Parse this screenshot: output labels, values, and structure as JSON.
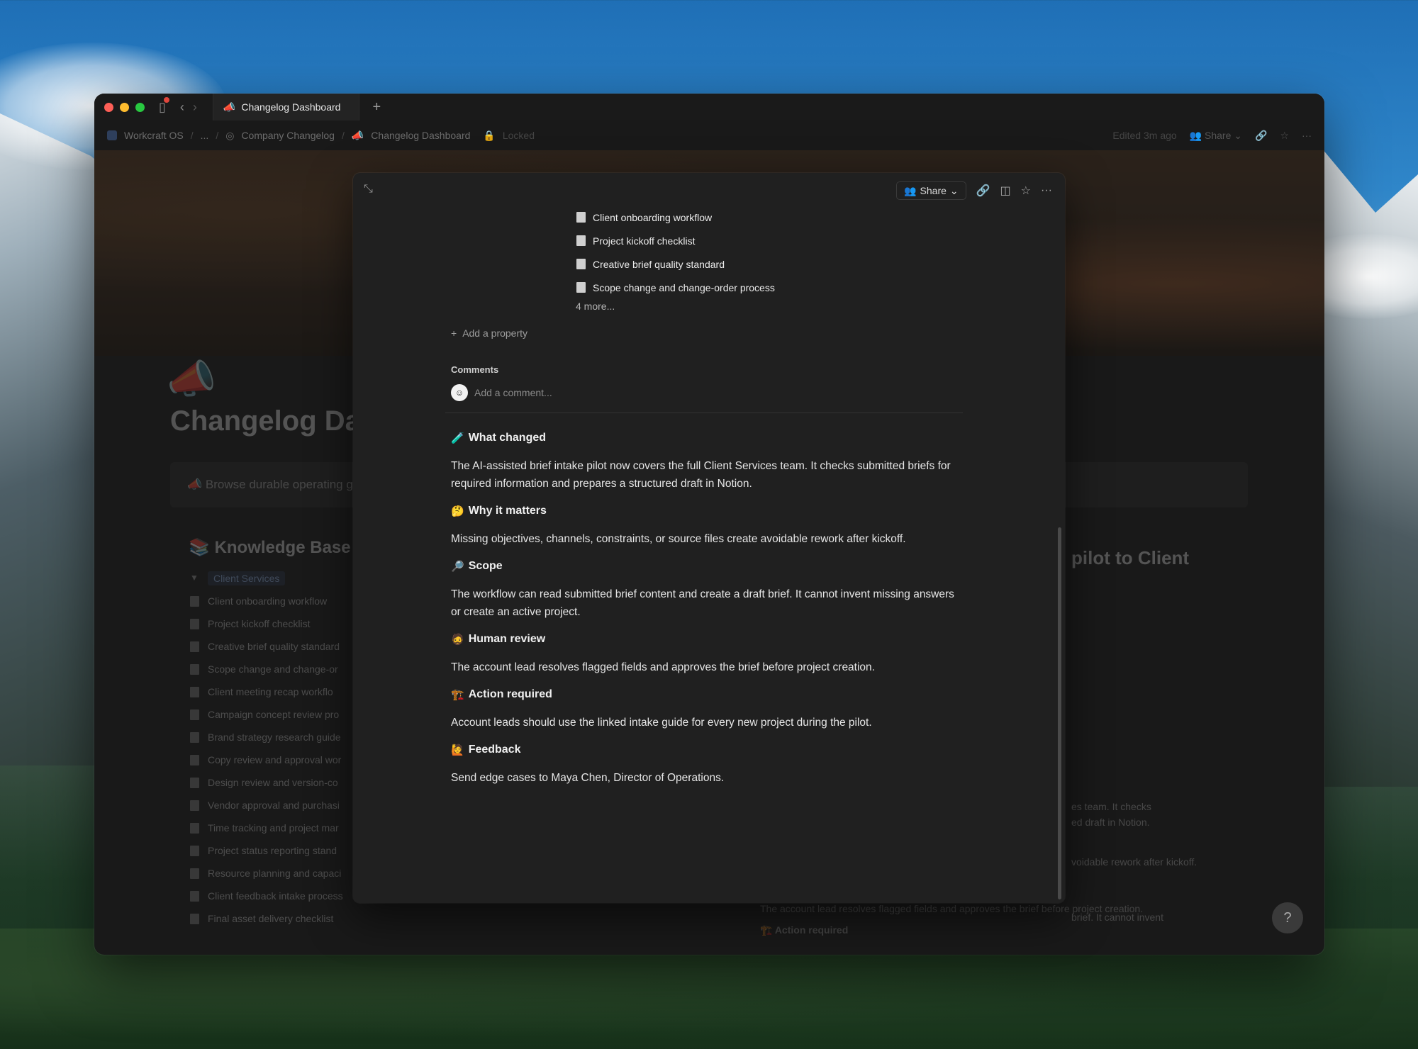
{
  "browser": {
    "tab_title": "Changelog Dashboard",
    "new_tab": "+"
  },
  "breadcrumb": {
    "items": [
      "Workcraft OS",
      "...",
      "Company Changelog",
      "Changelog Dashboard"
    ],
    "lock_label": "Locked"
  },
  "top_right": {
    "edited": "Edited 3m ago",
    "share": "Share"
  },
  "background_page": {
    "title": "Changelog Da",
    "callout": "Browse durable operating gu",
    "section_title": "Knowledge Base",
    "group_label": "Client Services",
    "items": [
      "Client onboarding workflow",
      "Project kickoff checklist",
      "Creative brief quality standard",
      "Scope change and change-or",
      "Client meeting recap workflo",
      "Campaign concept review pro",
      "Brand strategy research guide",
      "Copy review and approval wor",
      "Design review and version-co",
      "Vendor approval and purchasi",
      "Time tracking and project mar",
      "Project status reporting stand",
      "Resource planning and capaci",
      "Client feedback intake process",
      "Final asset delivery checklist"
    ],
    "right_title": "pilot to Client",
    "right_snippet_1": "es team. It checks",
    "right_snippet_2": "ed draft in Notion.",
    "right_snippet_3": "voidable rework after kickoff.",
    "right_snippet_4": "brief. It cannot invent",
    "bottom_text": "The account lead resolves flagged fields and approves the brief before project creation.",
    "bottom_heading": "Action required"
  },
  "modal": {
    "share_label": "Share",
    "related_pages": [
      "Client onboarding workflow",
      "Project kickoff checklist",
      "Creative brief quality standard",
      "Scope change and change-order process"
    ],
    "more_label": "4 more...",
    "add_property": "Add a property",
    "comments_label": "Comments",
    "comment_placeholder": "Add a comment...",
    "sections": [
      {
        "emoji": "🧪",
        "heading": "What changed",
        "text": "The AI-assisted brief intake pilot now covers the full Client Services team. It checks submitted briefs for required information and prepares a structured draft in Notion."
      },
      {
        "emoji": "🤔",
        "heading": "Why it matters",
        "text": "Missing objectives, channels, constraints, or source files create avoidable rework after kickoff."
      },
      {
        "emoji": "🔎",
        "heading": "Scope",
        "text": "The workflow can read submitted brief content and create a draft brief. It cannot invent missing answers or create an active project."
      },
      {
        "emoji": "🧔",
        "heading": "Human review",
        "text": "The account lead resolves flagged fields and approves the brief before project creation."
      },
      {
        "emoji": "🏗️",
        "heading": "Action required",
        "text": "Account leads should use the linked intake guide for every new project during the pilot."
      },
      {
        "emoji": "🙋",
        "heading": "Feedback",
        "text": "Send edge cases to Maya Chen, Director of Operations."
      }
    ]
  },
  "colors": {
    "window_bg": "#191919",
    "modal_bg": "#202020",
    "text_primary": "#e8e8e8",
    "traffic_red": "#fe5f57",
    "traffic_yellow": "#febc2e",
    "traffic_green": "#28c840"
  }
}
